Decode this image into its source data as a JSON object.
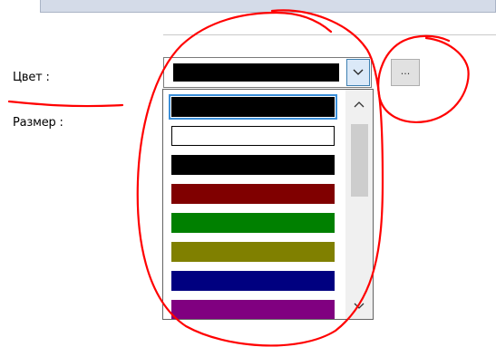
{
  "labels": {
    "color": "Цвет :",
    "size": "Размер :"
  },
  "combo": {
    "selected_color": "#000000",
    "dropdown_icon": "chevron-down-icon"
  },
  "ellipsis_button": {
    "label": "..."
  },
  "dropdown": {
    "items": [
      {
        "color": "#000000",
        "focused": true
      },
      {
        "color": "#ffffff",
        "focused": false
      },
      {
        "color": "#000000",
        "focused": false
      },
      {
        "color": "#800000",
        "focused": false
      },
      {
        "color": "#008000",
        "focused": false
      },
      {
        "color": "#808000",
        "focused": false
      },
      {
        "color": "#000080",
        "focused": false
      },
      {
        "color": "#800080",
        "focused": false
      }
    ],
    "scroll_up_icon": "chevron-up-icon",
    "scroll_down_icon": "chevron-down-icon"
  },
  "annotation_color": "#ff0000"
}
